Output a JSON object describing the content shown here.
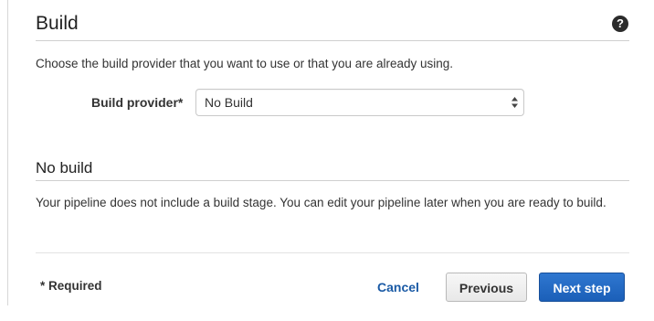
{
  "section": {
    "title": "Build",
    "help_icon": "question-circle-icon",
    "description": "Choose the build provider that you want to use or that you are already using."
  },
  "build_provider": {
    "label": "Build provider*",
    "selected": "No Build"
  },
  "no_build": {
    "title": "No build",
    "description": "Your pipeline does not include a build stage. You can edit your pipeline later when you are ready to build."
  },
  "footer": {
    "required_note": "* Required",
    "cancel_label": "Cancel",
    "previous_label": "Previous",
    "next_label": "Next step"
  },
  "colors": {
    "link": "#1a5aa5",
    "primary_button": "#2f77d0",
    "secondary_button": "#f7f7f7"
  }
}
